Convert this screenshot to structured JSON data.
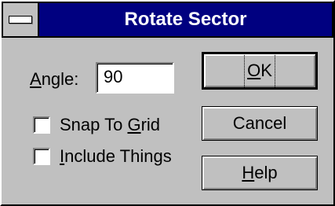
{
  "dialog": {
    "title": "Rotate Sector"
  },
  "angle": {
    "label_mnemonic": "A",
    "label_rest": "ngle:",
    "value": "90"
  },
  "options": [
    {
      "pre": "Snap To ",
      "mnemonic": "G",
      "post": "rid",
      "checked": false
    },
    {
      "pre": "",
      "mnemonic": "I",
      "post": "nclude Things",
      "checked": false
    }
  ],
  "buttons": {
    "ok": {
      "pre": "",
      "mnemonic": "O",
      "post": "K"
    },
    "cancel": {
      "label": "Cancel"
    },
    "help": {
      "pre": "",
      "mnemonic": "H",
      "post": "elp"
    }
  }
}
